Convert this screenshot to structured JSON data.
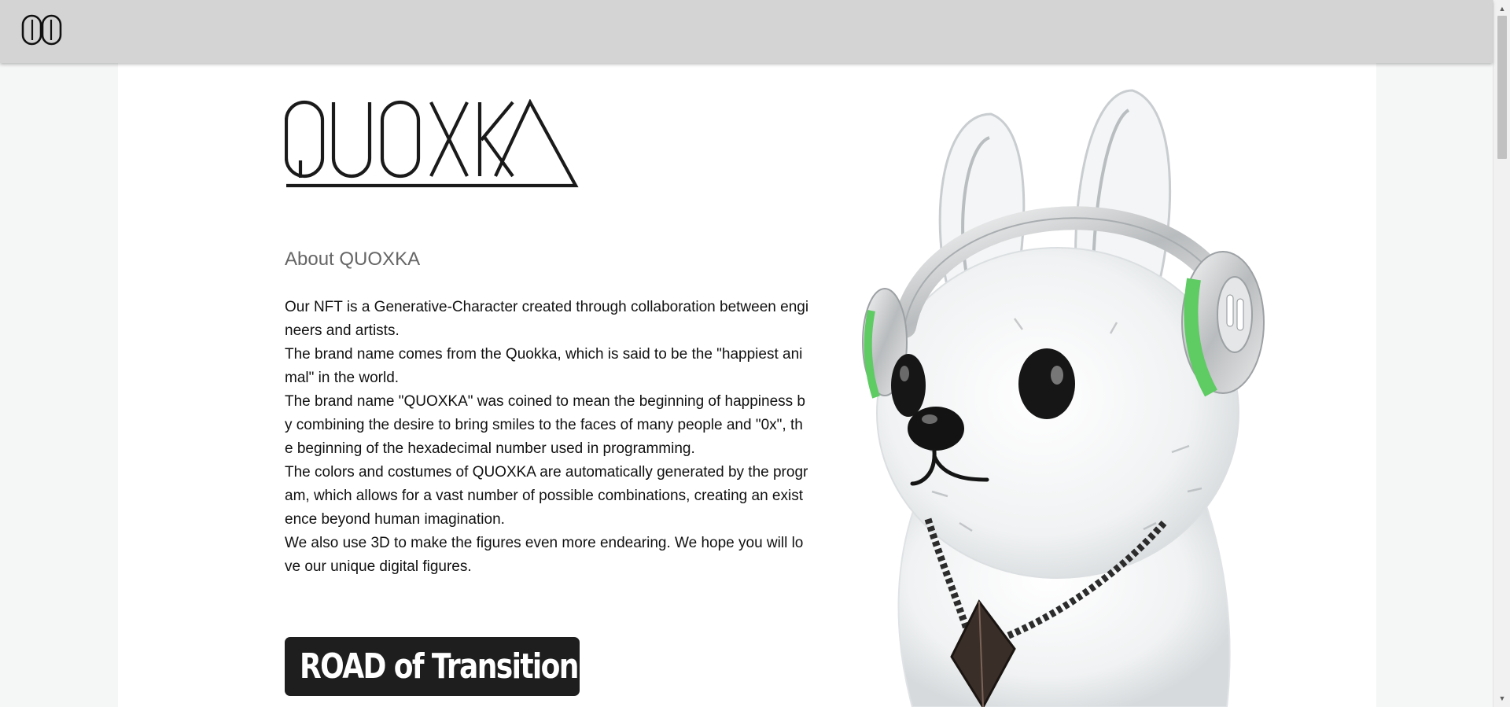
{
  "header": {
    "logo_icon": "qx-monogram-icon"
  },
  "hero": {
    "wordmark": "QUOXKA",
    "image_alt": "quokka-character-with-headphones-and-chain"
  },
  "about": {
    "heading": "About QUOXKA",
    "paragraphs": [
      "Our NFT is a Generative-Character created through collaboration between engineers and artists.",
      "The brand name comes from the Quokka, which is said to be the \"happiest animal\" in the world.",
      "The brand name \"QUOXKA\" was coined to mean the beginning of happiness by combining the desire to bring smiles to the faces of many people and \"0x\", the beginning of the hexadecimal number used in programming.",
      "The colors and costumes of QUOXKA are automatically generated by the program, which allows for a vast number of possible combinations, creating an existence beyond human imagination.",
      "We also use 3D to make the figures even more endearing. We hope you will love our unique digital figures."
    ]
  },
  "road": {
    "label": "ROAD of Transition"
  },
  "scrollbar": {
    "up_icon": "chevron-up-icon",
    "down_icon": "chevron-down-icon",
    "up_glyph": "▲",
    "down_glyph": "▼"
  },
  "colors": {
    "topbar": "#d4d4d4",
    "button_bg": "#1e1e1e",
    "accent_green": "#5ecb63"
  }
}
